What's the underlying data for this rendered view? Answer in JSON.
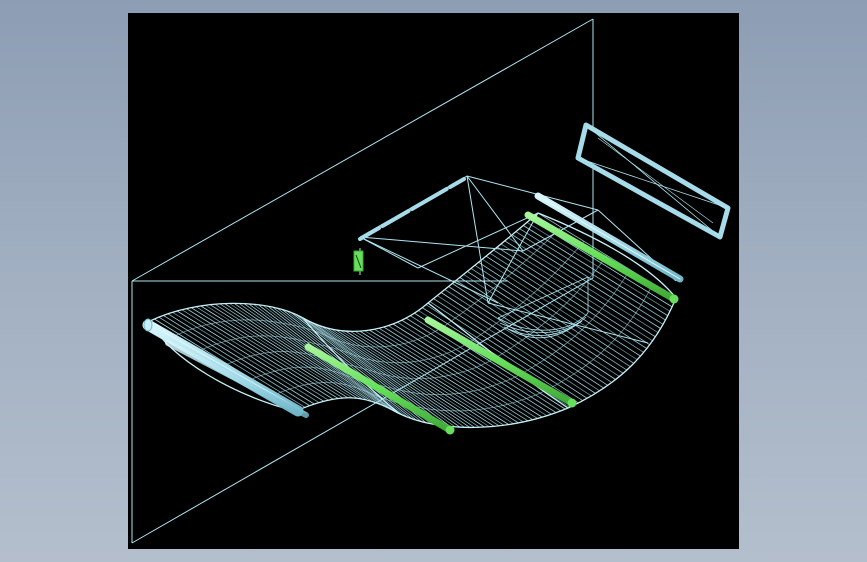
{
  "colors": {
    "background_top": "#8d9db3",
    "background_bottom": "#b4bfcd",
    "viewport": "#000000",
    "wireframe": "#aee6f2",
    "solid_cyan": "#a6dcea",
    "highlight_green": "#66e05a"
  },
  "scene": {
    "object": "curved-lounge-chair-wireframe",
    "view": "isometric-wireframe",
    "highlighted_rods": 3,
    "cyan_rods": 2
  }
}
